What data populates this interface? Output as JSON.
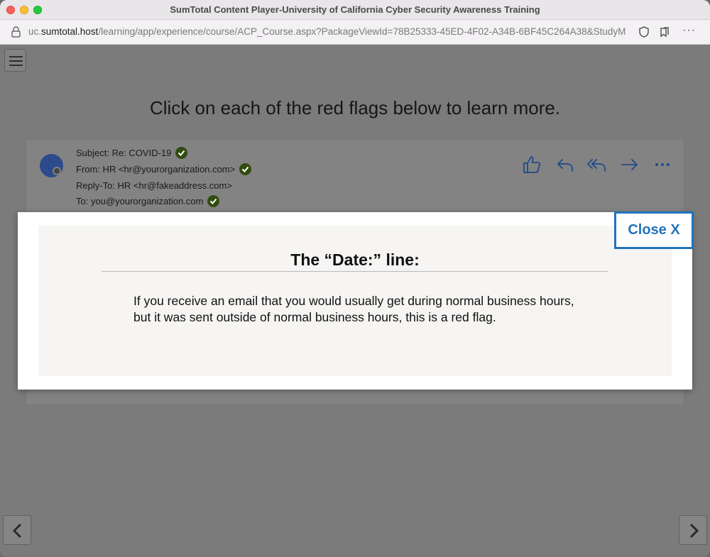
{
  "window": {
    "title": "SumTotal Content Player-University of California Cyber Security Awareness Training"
  },
  "address_bar": {
    "url_prefix": "uc.",
    "url_host": "sumtotal.host",
    "url_path": "/learning/app/experience/course/ACP_Course.aspx?PackageViewId=78B25333-45ED-4F02-A34B-6BF45C264A38&StudyM"
  },
  "page": {
    "headline": "Click on each of the red flags below to learn more."
  },
  "email": {
    "subject": "Subject: Re: COVID-19",
    "from": "From: HR <hr@yourorganization.com>",
    "reply_to": "Reply-To: HR <hr@fakeaddress.com>",
    "to": "To: you@yourorganization.com",
    "avatar_color": "#2d4b8c",
    "check_color": "#324b12",
    "action_icon_color": "#1f4a86"
  },
  "modal": {
    "title": "The “Date:” line:",
    "body": "If you receive an email that you would usually get during normal business hours, but it was sent outside of normal business hours, this is a red flag.",
    "close_label": "Close X",
    "close_color": "#2373b9"
  }
}
